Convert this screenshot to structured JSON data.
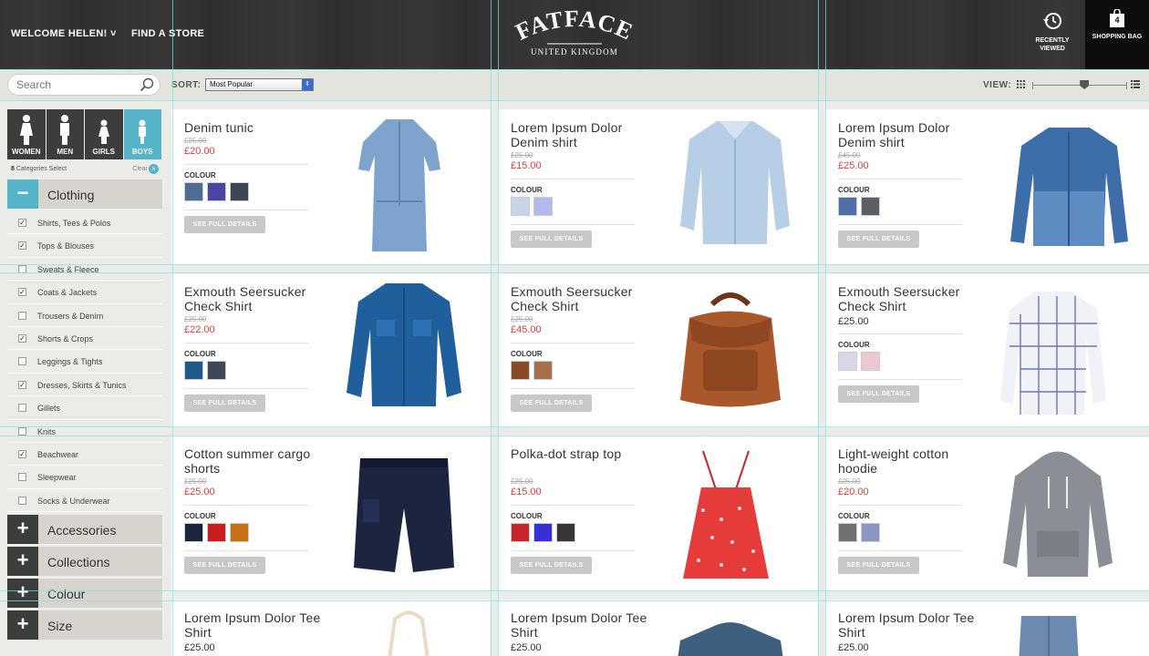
{
  "header": {
    "welcome": "WELCOME HELEN! ˅",
    "find_store": "FIND A STORE",
    "logo": "FATFACE",
    "logo_sub": "UNITED KINGDOM",
    "recently_viewed": "RECENTLY VIEWED",
    "bag_label": "SHOPPING BAG",
    "bag_count": "4"
  },
  "toolbar": {
    "search_placeholder": "Search",
    "sort_label": "SORT:",
    "sort_value": "Most Popular",
    "view_label": "VIEW:",
    "view_zoom_fraction": 0.55
  },
  "sidebar": {
    "genders": [
      {
        "label": "WOMEN",
        "active": false
      },
      {
        "label": "MEN",
        "active": false
      },
      {
        "label": "GIRLS",
        "active": false
      },
      {
        "label": "BOYS",
        "active": true
      }
    ],
    "cat_count": "8",
    "cat_text": "Categories Select",
    "clear": "Clear",
    "clothing": "Clothing",
    "filters": [
      {
        "label": "Shirts, Tees & Polos",
        "checked": true
      },
      {
        "label": "Tops & Blouses",
        "checked": true
      },
      {
        "label": "Sweats & Fleece",
        "checked": false
      },
      {
        "label": "Coats & Jackets",
        "checked": true
      },
      {
        "label": "Trousers & Denim",
        "checked": false
      },
      {
        "label": "Shorts & Crops",
        "checked": true
      },
      {
        "label": "Leggings & Tights",
        "checked": false
      },
      {
        "label": "Dresses, Skirts & Tunics",
        "checked": true
      },
      {
        "label": "Gillets",
        "checked": false
      },
      {
        "label": "Knits",
        "checked": false
      },
      {
        "label": "Beachwear",
        "checked": true
      },
      {
        "label": "Sleepwear",
        "checked": false
      },
      {
        "label": "Socks & Underwear",
        "checked": false
      }
    ],
    "accordions": [
      "Accessories",
      "Collections",
      "Colour",
      "Size"
    ]
  },
  "products": [
    {
      "title": "Denim tunic",
      "old_price": "£25.00",
      "price": "£20.00",
      "colour_label": "COLOUR",
      "swatches": [
        "#4f6d92",
        "#4a47a3",
        "#3d4555"
      ],
      "button": "SEE FULL DETAILS"
    },
    {
      "title": "Lorem Ipsum Dolor Denim shirt",
      "old_price": "£25.00",
      "price": "£15.00",
      "colour_label": "COLOUR",
      "swatches": [
        "#c6d4e6",
        "#b5b8ec"
      ],
      "button": "SEE FULL DETAILS"
    },
    {
      "title": "Lorem Ipsum Dolor Denim shirt",
      "old_price": "£45.00",
      "price": "£25.00",
      "colour_label": "COLOUR",
      "swatches": [
        "#4f6fa6",
        "#5b5f66"
      ],
      "button": "SEE FULL DETAILS"
    },
    {
      "title": "Exmouth Seersucker Check Shirt",
      "old_price": "£25.00",
      "price": "£22.00",
      "colour_label": "COLOUR",
      "swatches": [
        "#1f5a8f",
        "#3d4858"
      ],
      "button": "SEE FULL DETAILS"
    },
    {
      "title": "Exmouth Seersucker Check Shirt",
      "old_price": "£25.00",
      "price": "£45.00",
      "colour_label": "COLOUR",
      "swatches": [
        "#8a4a26",
        "#a8704a"
      ],
      "button": "SEE FULL DETAILS"
    },
    {
      "title": "Exmouth Seersucker Check Shirt",
      "old_price": "",
      "price": "£25.00",
      "colour_label": "COLOUR",
      "swatches": [
        "#d6d8ea",
        "#ebc9cf"
      ],
      "button": "SEE FULL DETAILS"
    },
    {
      "title": "Cotton summer cargo shorts",
      "old_price": "£25.00",
      "price": "£25.00",
      "colour_label": "COLOUR",
      "swatches": [
        "#1c2540",
        "#cc1b1b",
        "#c97016"
      ],
      "button": "SEE FULL DETAILS"
    },
    {
      "title": "Polka-dot strap top",
      "old_price": "£25.00",
      "price": "£15.00",
      "colour_label": "COLOUR",
      "swatches": [
        "#c4262b",
        "#3a2fd6",
        "#3a3538"
      ],
      "button": "SEE FULL DETAILS"
    },
    {
      "title": "Light-weight cotton hoodie",
      "old_price": "£25.00",
      "price": "£20.00",
      "colour_label": "COLOUR",
      "swatches": [
        "#6f6f74",
        "#8c95c4"
      ],
      "button": "SEE FULL DETAILS"
    },
    {
      "title": "Lorem Ipsum Dolor Tee Shirt",
      "old_price": "",
      "price": "£25.00"
    },
    {
      "title": "Lorem Ipsum Dolor Tee Shirt",
      "old_price": "",
      "price": "£25.00"
    },
    {
      "title": "Lorem Ipsum Dolor Tee Shirt",
      "old_price": "",
      "price": "£25.00"
    }
  ],
  "colors": {
    "accent": "#55b4c7",
    "sale": "#e23b3b",
    "header_bg": "#333333"
  }
}
